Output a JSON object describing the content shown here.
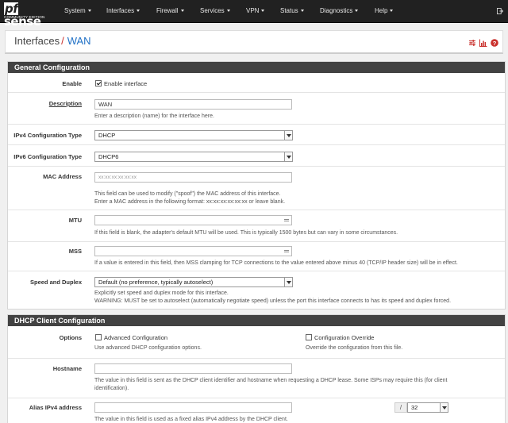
{
  "nav": {
    "logo_main": "sense",
    "logo_pf": "pf",
    "logo_sub": "COMMUNITY EDITION",
    "items": [
      {
        "label": "System"
      },
      {
        "label": "Interfaces"
      },
      {
        "label": "Firewall"
      },
      {
        "label": "Services"
      },
      {
        "label": "VPN"
      },
      {
        "label": "Status"
      },
      {
        "label": "Diagnostics"
      },
      {
        "label": "Help"
      }
    ]
  },
  "breadcrumb": {
    "parent": "Interfaces",
    "separator": "/",
    "current": "WAN"
  },
  "colors": {
    "navbar": "#212121",
    "panel_header": "#424242",
    "link": "#1e6fc5",
    "icon_red": "#c9302c"
  },
  "general": {
    "heading": "General Configuration",
    "enable": {
      "label": "Enable",
      "checkbox_label": "Enable interface",
      "checked": true
    },
    "description": {
      "label": "Description",
      "value": "WAN",
      "help": "Enter a description (name) for the interface here."
    },
    "ipv4_type": {
      "label": "IPv4 Configuration Type",
      "value": "DHCP"
    },
    "ipv6_type": {
      "label": "IPv6 Configuration Type",
      "value": "DHCP6"
    },
    "mac": {
      "label": "MAC Address",
      "placeholder": "xx:xx:xx:xx:xx:xx",
      "help1": "This field can be used to modify (\"spoof\") the MAC address of this interface.",
      "help2": "Enter a MAC address in the following format: xx:xx:xx:xx:xx:xx or leave blank."
    },
    "mtu": {
      "label": "MTU",
      "value": "",
      "help": "If this field is blank, the adapter's default MTU will be used. This is typically 1500 bytes but can vary in some circumstances."
    },
    "mss": {
      "label": "MSS",
      "value": "",
      "help": "If a value is entered in this field, then MSS clamping for TCP connections to the value entered above minus 40 (TCP/IP header size) will be in effect."
    },
    "speed": {
      "label": "Speed and Duplex",
      "value": "Default (no preference, typically autoselect)",
      "help1": "Explicitly set speed and duplex mode for this interface.",
      "help2": "WARNING: MUST be set to autoselect (automatically negotiate speed) unless the port this interface connects to has its speed and duplex forced."
    }
  },
  "dhcp": {
    "heading": "DHCP Client Configuration",
    "options": {
      "label": "Options",
      "advanced": {
        "label": "Advanced Configuration",
        "checked": false,
        "help": "Use advanced DHCP configuration options."
      },
      "override": {
        "label": "Configuration Override",
        "checked": false,
        "help": "Override the configuration from this file."
      }
    },
    "hostname": {
      "label": "Hostname",
      "value": "",
      "help1": "The value in this field is sent as the DHCP client identifier and hostname when requesting a DHCP lease. Some ISPs may require this (for client",
      "help2": "identification)."
    },
    "alias": {
      "label": "Alias IPv4 address",
      "value": "",
      "slash": "/",
      "prefix": "32",
      "help": "The value in this field is used as a fixed alias IPv4 address by the DHCP client."
    }
  }
}
